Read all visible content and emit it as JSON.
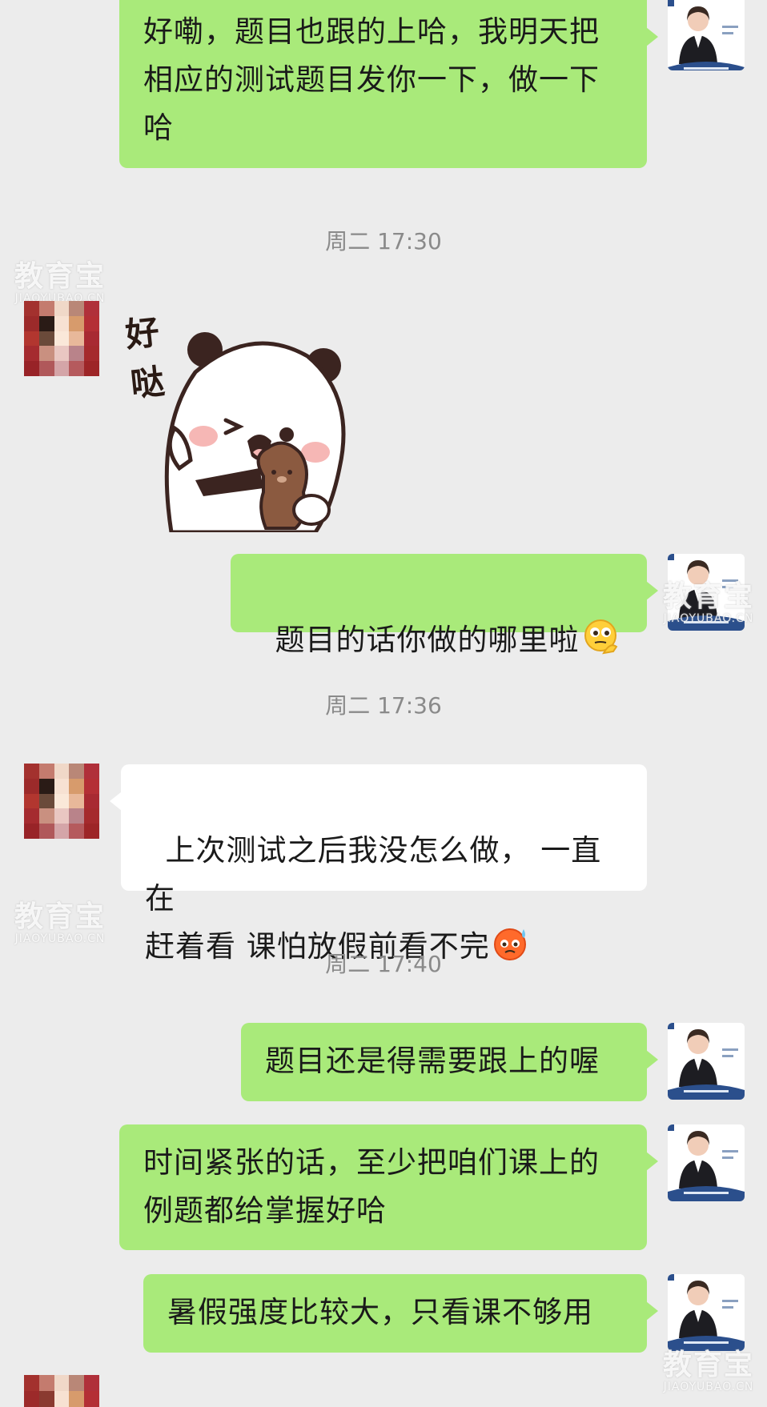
{
  "messages": {
    "m1": "好嘞，题目也跟的上哈，我明天把\n相应的测试题目发你一下，做一下\n哈",
    "m2": "题目的话你做的哪里啦",
    "m3": "上次测试之后我没怎么做， 一直在\n赶着看 课怕放假前看不完",
    "m4": "题目还是得需要跟上的喔",
    "m5": "时间紧张的话，至少把咱们课上的\n例题都给掌握好哈",
    "m6": "暑假强度比较大，只看课不够用"
  },
  "timestamps": {
    "t1": "周二 17:30",
    "t2": "周二 17:36",
    "t3": "周二 17:40"
  },
  "sticker": {
    "caption": "好\n哒"
  },
  "watermark": {
    "cn": "教育宝",
    "en": "JIAOYUBAO.CN"
  },
  "colors": {
    "sent_bubble": "#a9ea7a",
    "received_bubble": "#ffffff",
    "background": "#ececec",
    "timestamp_text": "#8a8a8a"
  }
}
